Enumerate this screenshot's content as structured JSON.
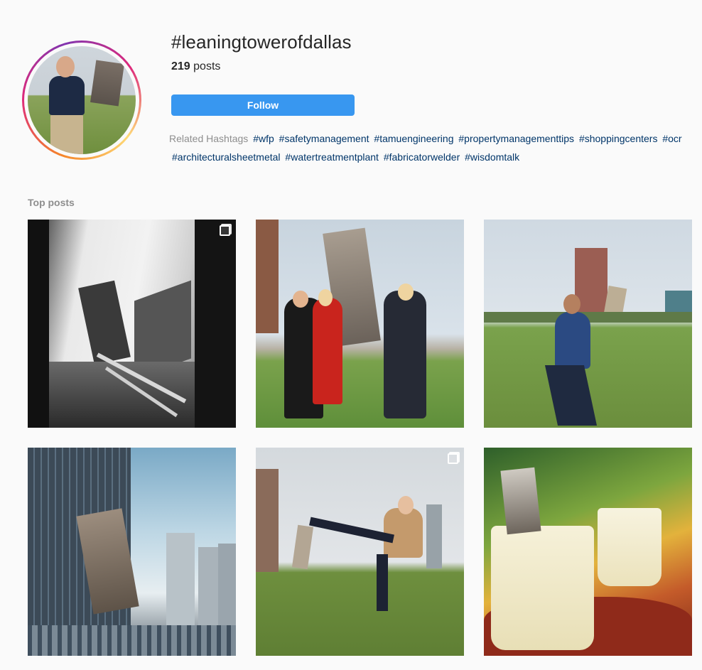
{
  "header": {
    "hashtag_title": "#leaningtowerofdallas",
    "post_count": "219",
    "post_count_suffix": " posts",
    "follow_label": "Follow"
  },
  "related": {
    "label": "Related Hashtags",
    "row1": [
      "#wfp",
      "#safetymanagement",
      "#tamuengineering",
      "#propertymanagementtips",
      "#shoppingcenters",
      "#ocr"
    ],
    "row2": [
      "#architecturalsheetmetal",
      "#watertreatmentplant",
      "#fabricatorwelder",
      "#wisdomtalk"
    ]
  },
  "top_posts": {
    "label": "Top posts"
  },
  "colors": {
    "accent": "#3897f0",
    "hashtag_link": "#003569",
    "muted": "#8e8e8e",
    "background": "#fafafa"
  }
}
